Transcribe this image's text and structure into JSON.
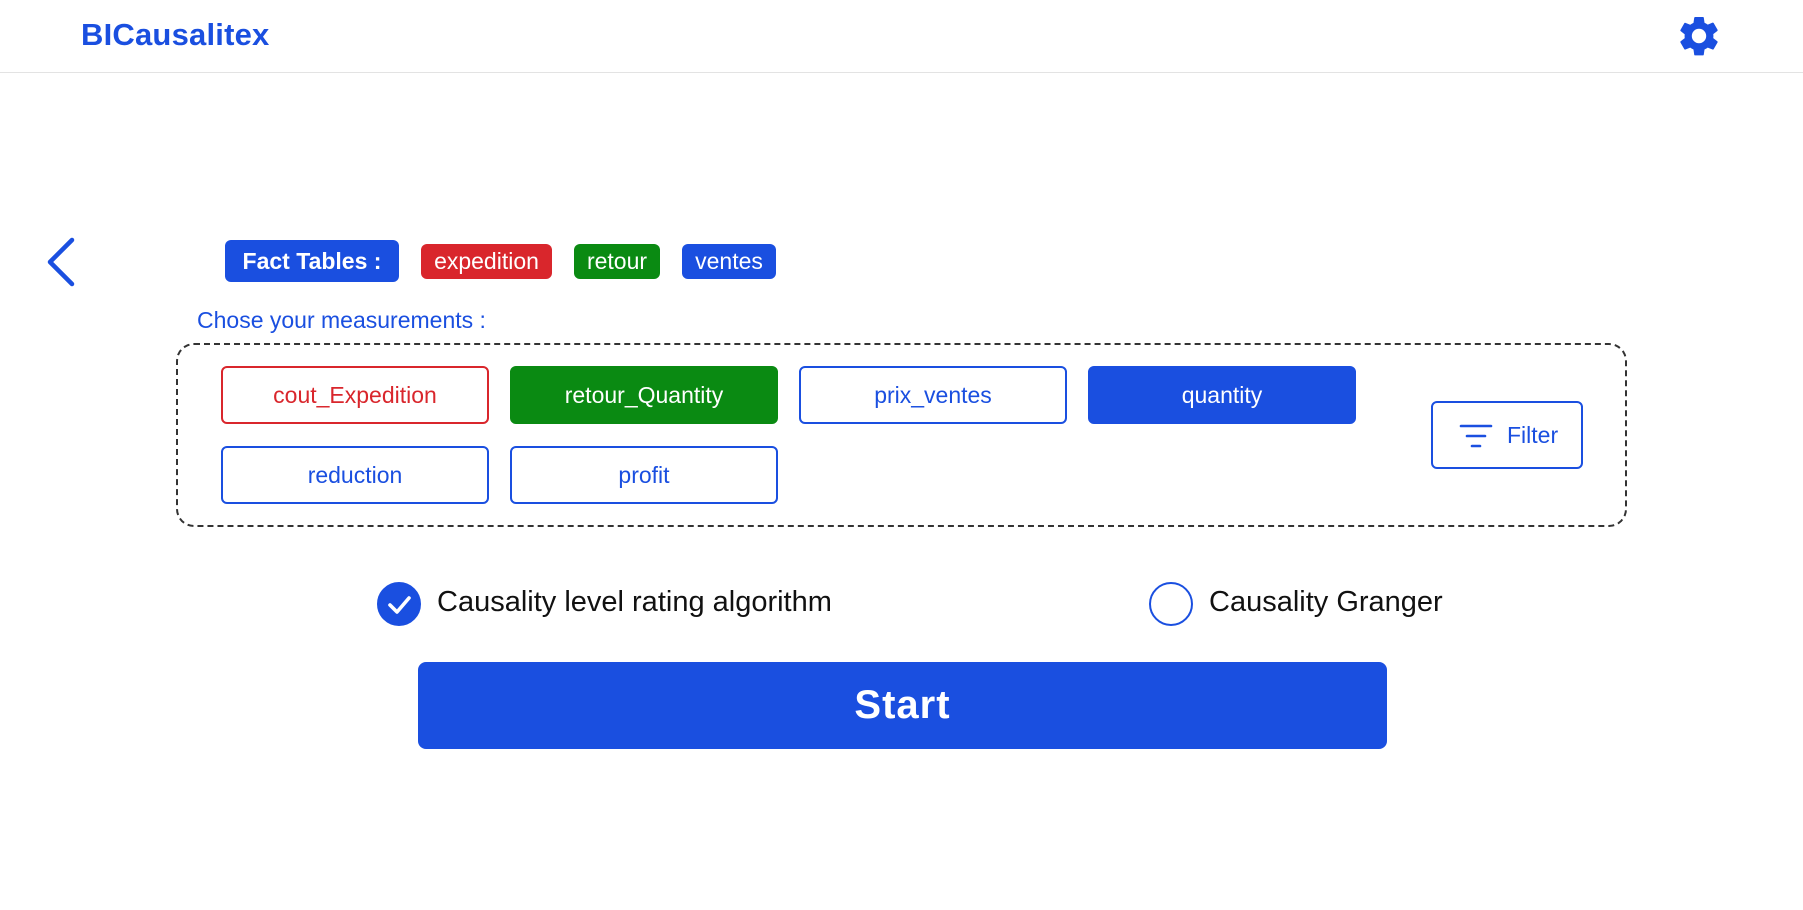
{
  "app": {
    "title": "BICausalitex"
  },
  "header": {
    "settings_icon": "gear-icon"
  },
  "nav": {
    "back_icon": "chevron-left-icon"
  },
  "fact_tables": {
    "title": "Fact Tables :",
    "tables": [
      {
        "label": "expedition",
        "color": "#d9262c"
      },
      {
        "label": "retour",
        "color": "#0a8a12"
      },
      {
        "label": "ventes",
        "color": "#1a4fe0"
      }
    ]
  },
  "measurements": {
    "prompt": "Chose your measurements :",
    "items": [
      {
        "label": "cout_Expedition",
        "table": "expedition",
        "selected": false,
        "color": "#d9262c"
      },
      {
        "label": "retour_Quantity",
        "table": "retour",
        "selected": true,
        "color": "#0a8a12"
      },
      {
        "label": "prix_ventes",
        "table": "ventes",
        "selected": false,
        "color": "#1a4fe0"
      },
      {
        "label": "quantity",
        "table": "ventes",
        "selected": true,
        "color": "#1a4fe0"
      },
      {
        "label": "reduction",
        "table": "ventes",
        "selected": false,
        "color": "#1a4fe0"
      },
      {
        "label": "profit",
        "table": "ventes",
        "selected": false,
        "color": "#1a4fe0"
      }
    ],
    "filter": {
      "label": "Filter",
      "icon": "filter-icon"
    }
  },
  "algorithms": [
    {
      "label": "Causality level rating algorithm",
      "checked": true
    },
    {
      "label": "Causality Granger",
      "checked": false
    }
  ],
  "start_label": "Start",
  "accent_color": "#1a4fe0"
}
